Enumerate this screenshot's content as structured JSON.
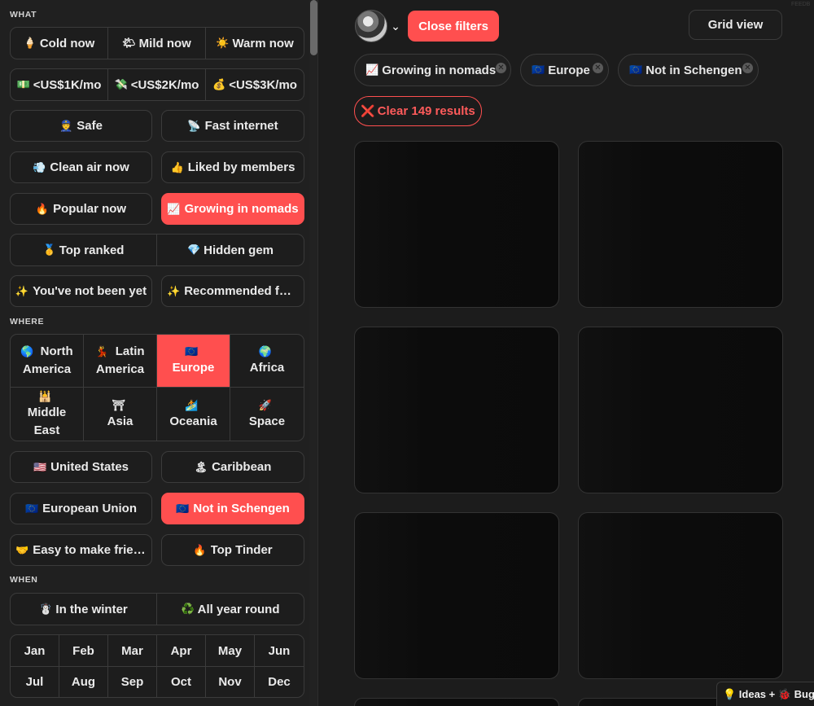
{
  "what": {
    "title": "WHAT",
    "temp": [
      {
        "emoji": "🍦",
        "label": "Cold now"
      },
      {
        "emoji": "🌤",
        "label": "Mild now"
      },
      {
        "emoji": "☀️",
        "label": "Warm now"
      }
    ],
    "cost": [
      {
        "emoji": "💵",
        "label": "<US$1K/mo"
      },
      {
        "emoji": "💸",
        "label": "<US$2K/mo"
      },
      {
        "emoji": "💰",
        "label": "<US$3K/mo"
      }
    ],
    "safe": {
      "emoji": "👮",
      "label": "Safe"
    },
    "internet": {
      "emoji": "📡",
      "label": "Fast internet"
    },
    "clean_air": {
      "emoji": "💨",
      "label": "Clean air now"
    },
    "liked": {
      "emoji": "👍",
      "label": "Liked by members"
    },
    "popular": {
      "emoji": "🔥",
      "label": "Popular now"
    },
    "growing": {
      "emoji": "📈",
      "label": "Growing in nomads"
    },
    "top_ranked": {
      "emoji": "🥇",
      "label": "Top ranked"
    },
    "hidden_gem": {
      "emoji": "💎",
      "label": "Hidden gem"
    },
    "not_been": {
      "emoji": "✨",
      "label": "You've not been yet"
    },
    "recommended": {
      "emoji": "✨",
      "label": "Recommended for..."
    }
  },
  "where": {
    "title": "WHERE",
    "continents": [
      {
        "emoji": "🌎",
        "line1": "North",
        "line2": "America"
      },
      {
        "emoji": "💃",
        "line1": "Latin",
        "line2": "America"
      },
      {
        "emoji": "🇪🇺",
        "line1": "",
        "line2": "Europe"
      },
      {
        "emoji": "🌍",
        "line1": "",
        "line2": "Africa"
      },
      {
        "emoji": "🕌",
        "line1": "Middle",
        "line2": "East"
      },
      {
        "emoji": "⛩",
        "line1": "",
        "line2": "Asia"
      },
      {
        "emoji": "🏄",
        "line1": "",
        "line2": "Oceania"
      },
      {
        "emoji": "🚀",
        "line1": "",
        "line2": "Space"
      }
    ],
    "us": {
      "emoji": "🇺🇸",
      "label": "United States"
    },
    "caribbean": {
      "emoji": "🏝",
      "label": "Caribbean"
    },
    "eu": {
      "emoji": "🇪🇺",
      "label": "European Union"
    },
    "schengen": {
      "emoji": "🇪🇺",
      "label": "Not in Schengen"
    },
    "friends": {
      "emoji": "🤝",
      "label": "Easy to make frien..."
    },
    "tinder": {
      "emoji": "🔥",
      "label": "Top Tinder"
    }
  },
  "when": {
    "title": "WHEN",
    "winter": {
      "emoji": "☃️",
      "label": "In the winter"
    },
    "year_round": {
      "emoji": "♻️",
      "label": "All year round"
    },
    "months": [
      "Jan",
      "Feb",
      "Mar",
      "Apr",
      "May",
      "Jun",
      "Jul",
      "Aug",
      "Sep",
      "Oct",
      "Nov",
      "Dec"
    ]
  },
  "header": {
    "close_filters": "Close filters",
    "grid_view": "Grid view",
    "chevron": "⌄",
    "tiny_label": "FEEDB"
  },
  "chips": [
    {
      "emoji": "📈",
      "label": "Growing in nomads"
    },
    {
      "emoji": "🇪🇺",
      "label": "Europe"
    },
    {
      "emoji": "🇪🇺",
      "label": "Not in Schengen"
    }
  ],
  "clear": {
    "emoji": "❌",
    "label": "Clear 149 results"
  },
  "feedback": "💡 Ideas + 🐞 Bugs",
  "colors": {
    "accent": "#ff4f4f",
    "background": "#1c1c1c",
    "sidebar": "#202020"
  }
}
